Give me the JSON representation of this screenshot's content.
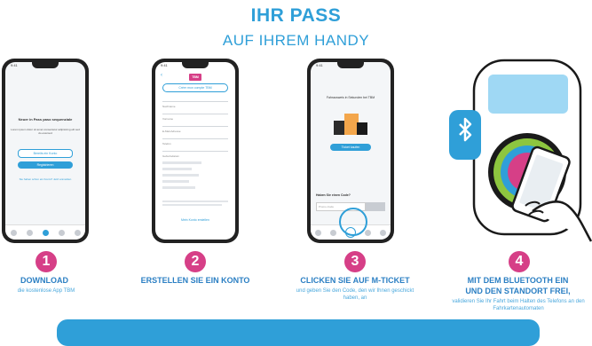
{
  "header": {
    "title": "IHR PASS",
    "subtitle": "AUF IHREM HANDY"
  },
  "phone1": {
    "heading": "Neuer in Pass paso sequenziale",
    "body": "Lorem ipsum dolor sit amet consectetur adipisicing elit sed do eiusmod",
    "btn_outline": "Bereits ein Konto",
    "btn_solid": "Registrieren",
    "footer": "Sie haben schon ein Konto? Jetzt anmelden"
  },
  "phone2": {
    "logo": "TBM",
    "form_title": "Créer mon compte TBM",
    "fields": [
      "Nachname",
      "Vorname",
      "E-Mail-Adresse",
      "Telefon",
      "Geburtsdatum"
    ],
    "bottom_link": "Mein Konto erstellen"
  },
  "phone3": {
    "heading": "Fahrausweis in Sekunden bei TBM",
    "btn_solid": "Ticket kaufen",
    "code_label": "Haben Sie einen Code?",
    "input_placeholder": "Promo-Code"
  },
  "steps": [
    {
      "num": "1",
      "title": "DOWNLOAD",
      "desc": "die kostenlose App TBM"
    },
    {
      "num": "2",
      "title": "ERSTELLEN SIE EIN KONTO",
      "desc": ""
    },
    {
      "num": "3",
      "title": "CLICKEN SIE AUF M-TICKET",
      "desc": "und geben Sie den Code, den wir Ihnen geschickt haben, an"
    },
    {
      "num": "4",
      "title_line1": "MIT DEM BLUETOOTH EIN",
      "title_line2": "UND DEN STANDORT FREI,",
      "desc": "validieren Sie Ihr Fahrt beim Halten des Telefons an den Fahrkartenautomaten"
    }
  ],
  "colors": {
    "brand_blue": "#2f9fd8",
    "accent_pink": "#d63f87"
  }
}
